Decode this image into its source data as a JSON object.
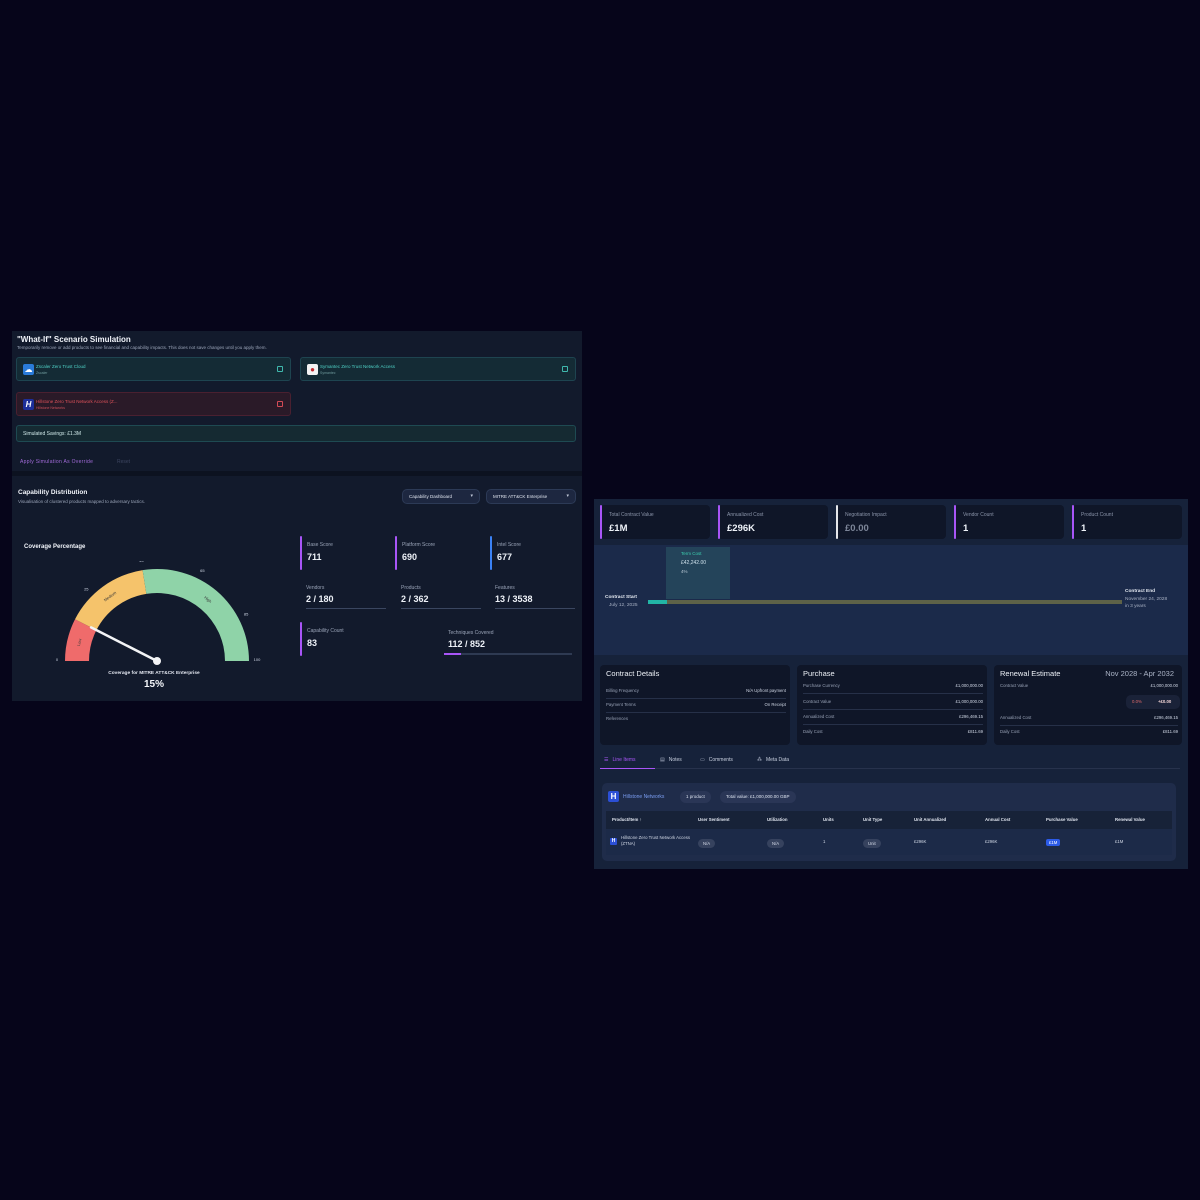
{
  "simulation": {
    "title": "\"What-If\" Scenario Simulation",
    "subtitle": "Temporarily remove or add products to see financial and capability impacts. This does not save changes until you apply them.",
    "products": [
      {
        "name": "Zscaler Zero Trust Cloud",
        "vendor": "Zscaler",
        "state": "active",
        "logo": "cloud-logo-icon"
      },
      {
        "name": "Symantec Zero Trust Network Access",
        "vendor": "Symantec",
        "state": "active",
        "logo": "symantec-logo-icon"
      },
      {
        "name": "Hillstone Zero Trust Network Access (Z...",
        "vendor": "Hillstone Networks",
        "state": "removed",
        "logo": "H"
      }
    ],
    "savings_label": "Simulated Savings: £1.3M",
    "apply_label": "Apply Simulation As Override",
    "reset_label": "Reset"
  },
  "capability": {
    "title": "Capability Distribution",
    "subtitle": "Visualisation of clustered products mapped to adversary tactics.",
    "dropdown_view": "Capability Dashboard",
    "dropdown_framework": "MITRE ATT&CK Enterprise",
    "coverage_label": "Coverage Percentage",
    "gauge": {
      "value_percent": 15,
      "ticks": [
        "0",
        "25",
        "45",
        "65",
        "85",
        "100"
      ],
      "bands": [
        "Low",
        "Medium",
        "High"
      ],
      "caption": "Coverage for MITRE ATT&CK Enterprise",
      "value_label": "15%"
    },
    "scores": [
      {
        "label": "Base Score",
        "value": "711",
        "color": "#a855f7"
      },
      {
        "label": "Platform Score",
        "value": "690",
        "color": "#a855f7"
      },
      {
        "label": "Intel Score",
        "value": "677",
        "color": "#3b82f6"
      }
    ],
    "stats": [
      {
        "label": "Vendors",
        "value": "2 / 180"
      },
      {
        "label": "Products",
        "value": "2 / 362"
      },
      {
        "label": "Features",
        "value": "13 / 3538"
      }
    ],
    "capability_count": {
      "label": "Capability Count",
      "value": "83"
    },
    "techniques": {
      "label": "Techniques Covered",
      "value": "112 / 852",
      "fraction": 0.13
    }
  },
  "contract": {
    "kpis": [
      {
        "label": "Total Contract Value",
        "value": "£1M",
        "color": "#a855f7"
      },
      {
        "label": "Annualized Cost",
        "value": "£296K",
        "color": "#a855f7"
      },
      {
        "label": "Negotiation Impact",
        "value": "£0.00",
        "color": "#e5e7eb"
      },
      {
        "label": "Vendor Count",
        "value": "1",
        "color": "#a855f7"
      },
      {
        "label": "Product Count",
        "value": "1",
        "color": "#a855f7"
      }
    ],
    "timeline": {
      "term_cost_title": "Term Cost",
      "term_cost_value": "£42,242.00",
      "term_cost_pct": "4%",
      "start_label": "Contract Start",
      "start_date": "July 12, 2025",
      "end_label": "Contract End",
      "end_date": "November 24, 2028",
      "end_remaining": "in 3 years",
      "progress_fraction": 0.04
    },
    "details": {
      "title": "Contract Details",
      "rows": [
        {
          "label": "Billing Frequency",
          "value": "N/A Upfront payment"
        },
        {
          "label": "Payment Terms",
          "value": "On Receipt"
        },
        {
          "label": "References",
          "value": ""
        }
      ]
    },
    "purchase": {
      "title": "Purchase",
      "rows": [
        {
          "label": "Purchase Currency",
          "value": "£1,000,000.00"
        },
        {
          "label": "Contract Value",
          "value": "£1,000,000.00"
        },
        {
          "label": "Annualized Cost",
          "value": "£296,469.15"
        },
        {
          "label": "Daily Cost",
          "value": "£811.69"
        }
      ]
    },
    "renewal": {
      "title": "Renewal Estimate",
      "range": "Nov 2028 - Apr 2032",
      "contract_value_label": "Contract Value",
      "contract_value": "£1,000,000.00",
      "delta_pct": "0.0%",
      "delta_amount": "+£0.00",
      "rows": [
        {
          "label": "Annualized Cost",
          "value": "£296,469.15"
        },
        {
          "label": "Daily Cost",
          "value": "£811.69"
        }
      ]
    },
    "tabs": [
      {
        "label": "Line Items",
        "icon": "list-icon"
      },
      {
        "label": "Notes",
        "icon": "note-icon"
      },
      {
        "label": "Comments",
        "icon": "comment-icon"
      },
      {
        "label": "Meta Data",
        "icon": "meta-icon"
      }
    ],
    "vendor": {
      "name": "Hillstone Networks",
      "logo": "H",
      "product_pill": "1 product",
      "total_pill": "Total value: £1,000,000.00 GBP"
    },
    "table": {
      "headers": [
        "Product/Item ↑",
        "User Sentiment",
        "Utilization",
        "Units",
        "Unit Type",
        "Unit Annualized",
        "Annual Cost",
        "Purchase Value",
        "Renewal Value"
      ],
      "row": {
        "product": "Hillstone Zero Trust Network Access (ZTNA)",
        "sentiment": "N/A",
        "utilization": "N/A",
        "units": "1",
        "unit_type": "Unit",
        "unit_annualized": "£296K",
        "annual_cost": "£296K",
        "purchase_value": "£1M",
        "renewal_value": "£1M"
      }
    }
  }
}
